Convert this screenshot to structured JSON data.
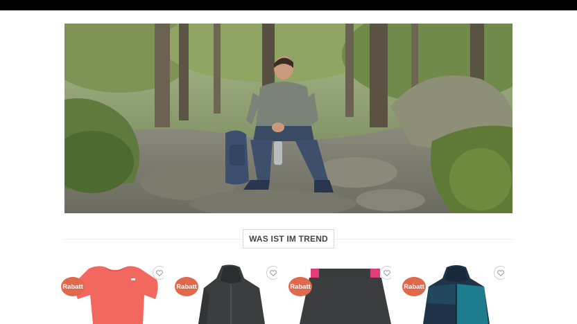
{
  "section": {
    "trend_title": "WAS IST IM TREND"
  },
  "products": [
    {
      "badge": "Rabatt",
      "wishlist_icon": "heart-icon",
      "image": "coral-t-shirt"
    },
    {
      "badge": "Rabatt",
      "wishlist_icon": "heart-icon",
      "image": "dark-grey-hooded-jacket"
    },
    {
      "badge": "Rabatt",
      "wishlist_icon": "heart-icon",
      "image": "dark-skirt-pink-waistband"
    },
    {
      "badge": "Rabatt",
      "wishlist_icon": "heart-icon",
      "image": "navy-teal-rain-jacket"
    }
  ],
  "colors": {
    "badge": "#e0684b",
    "topbar": "#000000",
    "divider": "#ececec"
  }
}
